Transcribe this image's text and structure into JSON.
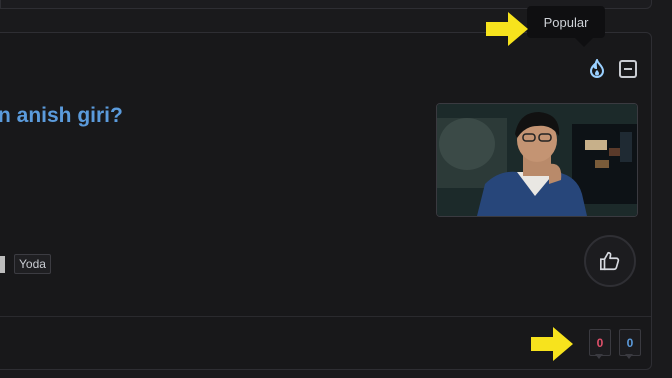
{
  "post": {
    "title": "n anish giri?",
    "tag": "Yoda"
  },
  "tooltip": {
    "label": "Popular"
  },
  "counters": {
    "red": {
      "value": "0",
      "color": "#e0506a"
    },
    "blue": {
      "value": "0",
      "color": "#5b9bdc"
    }
  },
  "icons": {
    "popular": "flame-icon",
    "collapse": "minus-square-icon",
    "like": "thumbs-up-icon",
    "annotation": "yellow-arrow-icon"
  },
  "colors": {
    "background": "#1a1a1c",
    "title": "#5b9bdc",
    "annotation_arrow": "#f7e31d"
  }
}
